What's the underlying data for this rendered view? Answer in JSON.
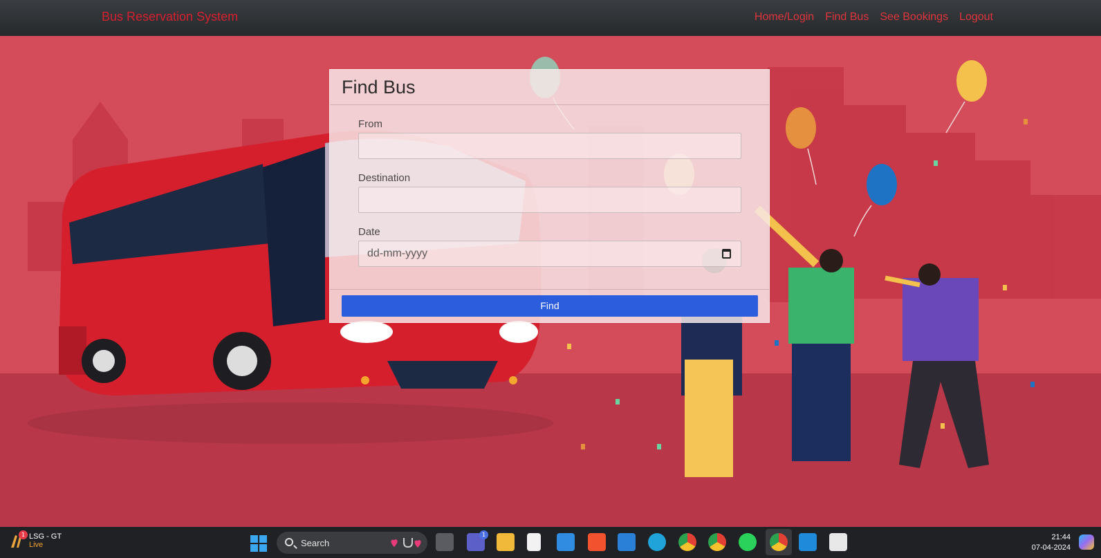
{
  "navbar": {
    "brand": "Bus Reservation System",
    "links": [
      "Home/Login",
      "Find Bus",
      "See Bookings",
      "Logout"
    ]
  },
  "form": {
    "title": "Find Bus",
    "fields": [
      {
        "label": "From",
        "value": ""
      },
      {
        "label": "Destination",
        "value": ""
      },
      {
        "label": "Date",
        "placeholder": "dd-mm-yyyy"
      }
    ],
    "submit_label": "Find"
  },
  "taskbar": {
    "widget_title": "LSG - GT",
    "widget_status": "Live",
    "widget_badge": "1",
    "search_placeholder": "Search",
    "teams_badge": "1",
    "apps": [
      "task-view",
      "teams",
      "file-explorer",
      "notepad",
      "microsoft-store",
      "brave",
      "mail",
      "edge",
      "chrome-profile-1",
      "chrome-profile-2",
      "whatsapp",
      "chrome-active",
      "vscode",
      "snipping-tool"
    ],
    "time": "21:44",
    "date": "07-04-2024"
  },
  "colors": {
    "brand": "#d5202e",
    "button": "#2b5ddd",
    "background": "#d44b59"
  }
}
